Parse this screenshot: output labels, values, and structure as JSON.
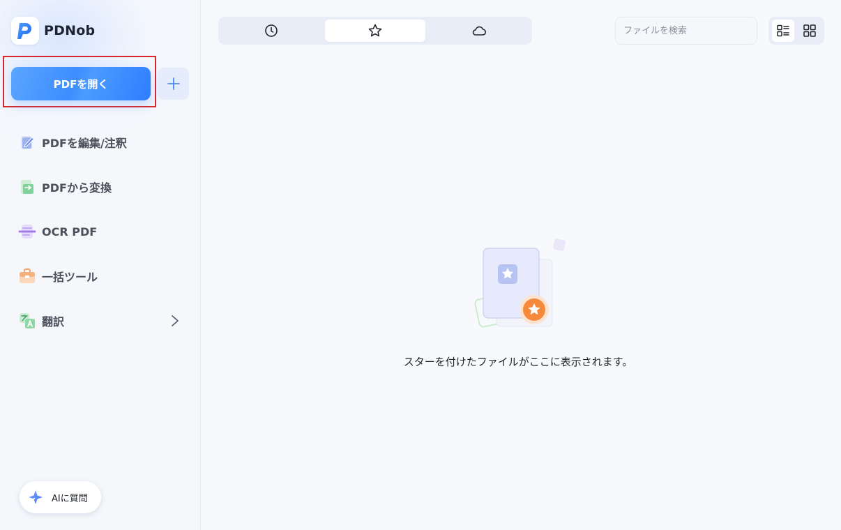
{
  "app": {
    "name": "PDNob"
  },
  "sidebar": {
    "open_button_label": "PDFを開く",
    "add_button_icon": "plus-icon",
    "items": [
      {
        "label": "PDFを編集/注釈",
        "icon": "edit-document-icon"
      },
      {
        "label": "PDFから変換",
        "icon": "convert-document-icon"
      },
      {
        "label": "OCR PDF",
        "icon": "ocr-icon"
      },
      {
        "label": "一括ツール",
        "icon": "toolbox-icon"
      },
      {
        "label": "翻訳",
        "icon": "translate-icon",
        "has_submenu": true
      }
    ],
    "ai_button_label": "AIに質問"
  },
  "tabs": [
    {
      "icon": "clock-icon",
      "active": false
    },
    {
      "icon": "star-icon",
      "active": true
    },
    {
      "icon": "cloud-icon",
      "active": false
    }
  ],
  "search": {
    "placeholder": "ファイルを検索",
    "value": ""
  },
  "view_toggle": [
    {
      "icon": "list-view-icon",
      "active": true
    },
    {
      "icon": "grid-view-icon",
      "active": false
    }
  ],
  "empty_state": {
    "message": "スターを付けたファイルがここに表示されます。"
  },
  "colors": {
    "accent": "#3d8dff",
    "highlight_border": "#d9262c",
    "star_badge": "#f58a3c"
  }
}
